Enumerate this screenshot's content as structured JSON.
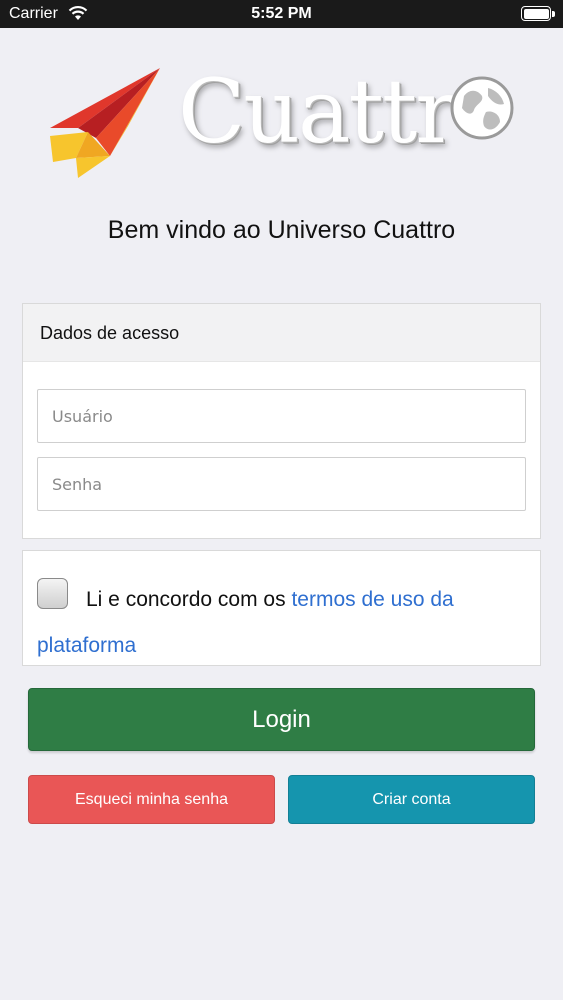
{
  "status_bar": {
    "carrier": "Carrier",
    "time": "5:52 PM",
    "battery_level": 1.0
  },
  "logo": {
    "text": "Cuattr",
    "icons": [
      "paper-plane-icon",
      "globe-icon"
    ],
    "colors": {
      "red": "#d9262b",
      "yellow": "#f5c02a"
    }
  },
  "welcome": "Bem vindo ao Universo Cuattro",
  "access": {
    "header": "Dados de acesso",
    "username_placeholder": "Usuário",
    "password_placeholder": "Senha"
  },
  "terms": {
    "checked": false,
    "text": "Li e concordo com os",
    "link": "termos de uso da plataforma"
  },
  "buttons": {
    "login": "Login",
    "forgot": "Esqueci minha senha",
    "create": "Criar conta"
  },
  "colors": {
    "login": "#2f7d45",
    "forgot": "#e95656",
    "create": "#1595ae",
    "link": "#2f6fd0",
    "background": "#efeff4"
  }
}
